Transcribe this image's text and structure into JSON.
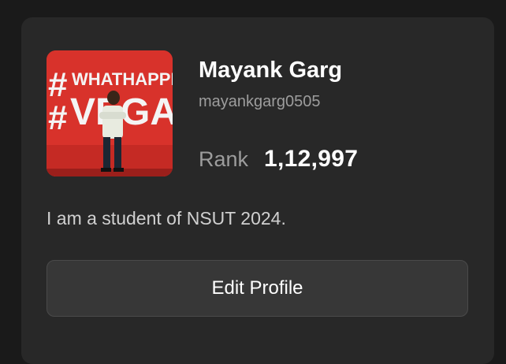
{
  "profile": {
    "name": "Mayank Garg",
    "username": "mayankgarg0505",
    "rank_label": "Rank",
    "rank_value": "1,12,997",
    "bio": "I am a student of NSUT 2024.",
    "avatar": {
      "description_icon": "profile-photo",
      "backdrop_text": "#WHATHAPPENS VEGAS"
    }
  },
  "actions": {
    "edit_profile_label": "Edit Profile"
  },
  "colors": {
    "page_bg": "#1a1a1a",
    "card_bg": "#282828",
    "button_bg": "#373737",
    "muted_text": "#9d9d9d",
    "primary_text": "#ffffff",
    "avatar_red": "#d8322b"
  }
}
